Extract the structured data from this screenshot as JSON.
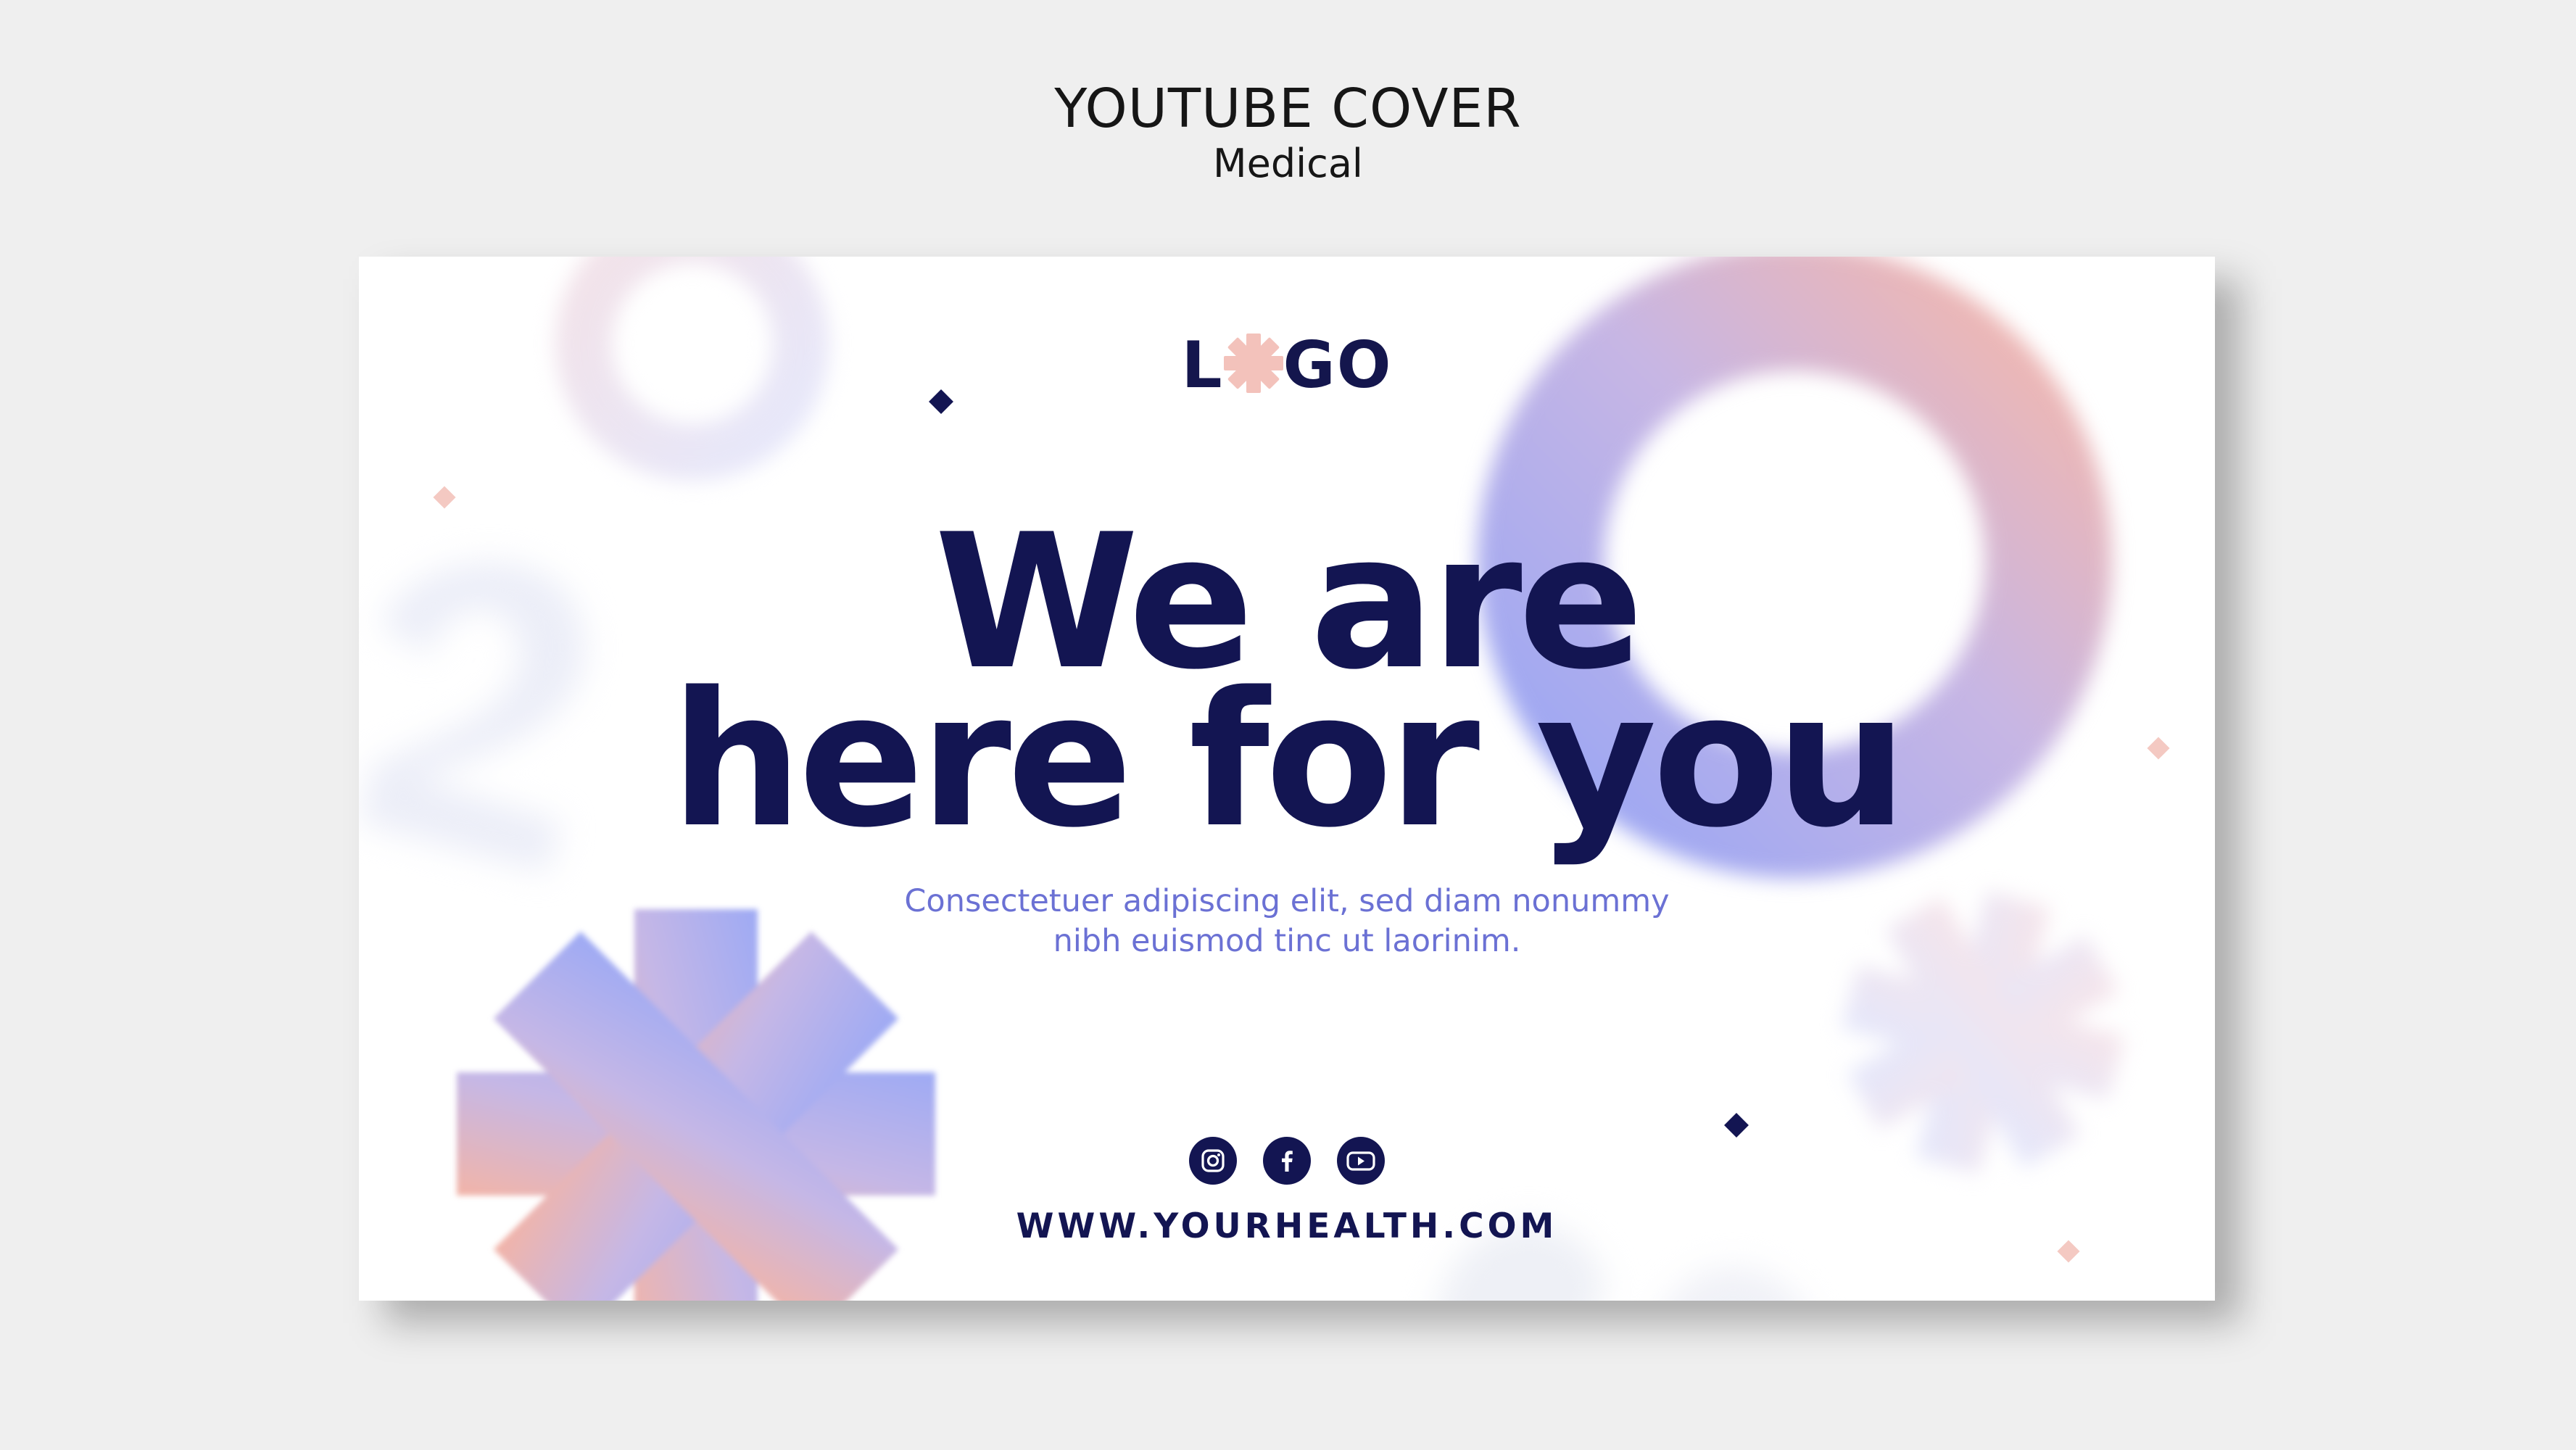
{
  "header": {
    "title": "YOUTUBE COVER",
    "subtitle": "Medical"
  },
  "cover": {
    "logo": {
      "letter_left": "L",
      "letters_right": "GO",
      "symbol_icon": "asterisk-icon"
    },
    "headline": {
      "line1": "We are",
      "line2": "here for you"
    },
    "body": {
      "line1": "Consectetuer adipiscing elit, sed diam nonummy",
      "line2": "nibh euismod tinc ut laorinim."
    },
    "social_icons": [
      "instagram-icon",
      "facebook-icon",
      "youtube-icon"
    ],
    "website": "WWW.YOURHEALTH.COM"
  },
  "colors": {
    "background": "#efefef",
    "card": "#ffffff",
    "navy": "#131552",
    "body_text": "#6b71d4",
    "gradient_pink": "#f2b8b0",
    "gradient_blue": "#a4acf2"
  }
}
